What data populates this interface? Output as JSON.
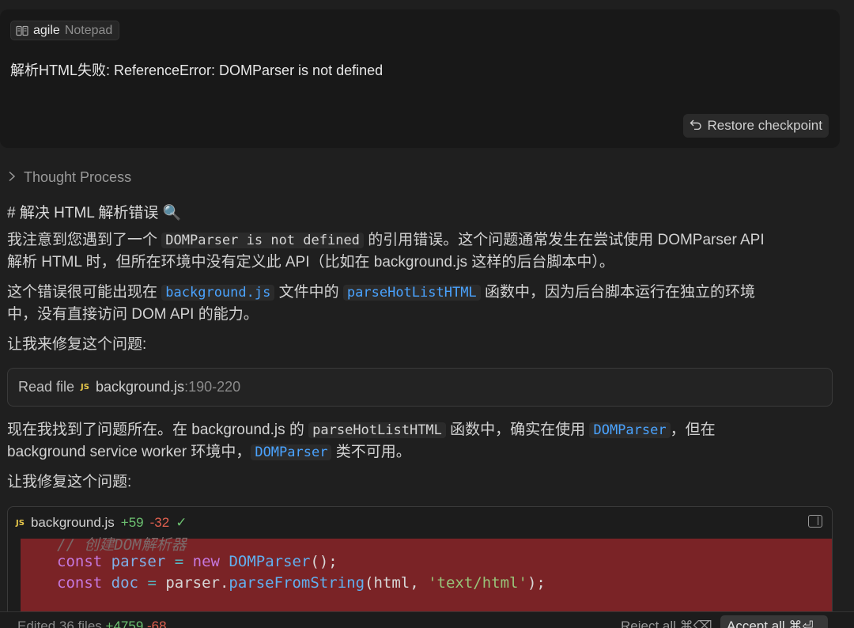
{
  "user_message": {
    "context_chip": {
      "name": "agile",
      "kind": "Notepad",
      "icon": "notebook-icon"
    },
    "text": "解析HTML失败: ReferenceError: DOMParser is not defined",
    "restore_label": "Restore checkpoint"
  },
  "thought_process_label": "Thought Process",
  "heading": "# 解决 HTML 解析错误 🔍",
  "p1": {
    "a": "我注意到您遇到了一个 ",
    "code": "DOMParser is not defined",
    "b": " 的引用错误。这个问题通常发生在尝试使用 DOMParser API",
    "c": "解析 HTML 时，但所在环境中没有定义此 API（比如在 background.js 这样的后台脚本中）。"
  },
  "p2": {
    "a": "这个错误很可能出现在 ",
    "code1": "background.js",
    "b": " 文件中的 ",
    "code2": "parseHotListHTML",
    "c": " 函数中，因为后台脚本运行在独立的环境",
    "d": "中，没有直接访问 DOM API 的能力。"
  },
  "p3": "让我来修复这个问题:",
  "read_file": {
    "label": "Read file",
    "badge": "JS",
    "file": "background.js",
    "range": ":190-220"
  },
  "p4": {
    "a": "现在我找到了问题所在。在 background.js 的 ",
    "code1": "parseHotListHTML",
    "b": " 函数中，确实在使用 ",
    "code2": "DOMParser",
    "c": "，但在",
    "d": "background service worker 环境中，",
    "code3": "DOMParser",
    "e": " 类不可用。"
  },
  "p5": "让我修复这个问题:",
  "diff": {
    "badge": "JS",
    "file": "background.js",
    "added": "+59",
    "removed": "-32",
    "check": "✓",
    "lines": {
      "comment": "// 创建DOM解析器",
      "l2_kw": "const",
      "l2_var": "parser",
      "l2_op": "=",
      "l2_new": "new",
      "l2_fn": "DOMParser",
      "l2_rest": "();",
      "l3_kw": "const",
      "l3_var": "doc",
      "l3_op": "=",
      "l3_obj": "parser.",
      "l3_fn": "parseFromString",
      "l3_a": "(html, ",
      "l3_str": "'text/html'",
      "l3_end": ");"
    }
  },
  "bottom": {
    "edited": "Edited 36 files",
    "added": "+4759",
    "removed": "-68",
    "reject": "Reject all ⌘⌫",
    "accept": "Accept all ⌘⏎"
  }
}
